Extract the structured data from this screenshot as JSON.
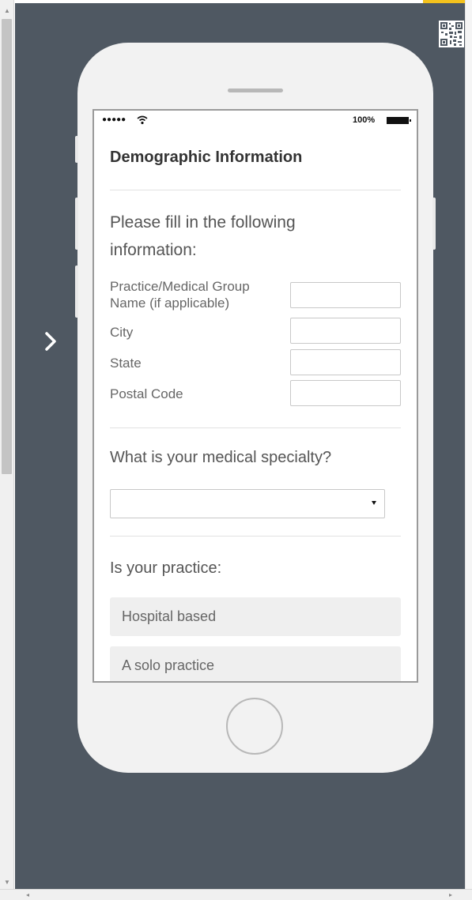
{
  "status_bar": {
    "signal": "●●●●●",
    "battery_percent": "100%"
  },
  "form": {
    "title": "Demographic Information",
    "intro": "Please fill in the following information:",
    "fields": [
      {
        "label": "Practice/Medical Group Name (if applicable)",
        "value": ""
      },
      {
        "label": "City",
        "value": ""
      },
      {
        "label": "State",
        "value": ""
      },
      {
        "label": "Postal Code",
        "value": ""
      }
    ],
    "specialty_question": "What is your medical specialty?",
    "specialty_selected": "",
    "practice_question": "Is your practice:",
    "practice_options": [
      "Hospital based",
      "A solo practice"
    ]
  },
  "icons": {
    "qr": "qr-code-icon",
    "nav": "chevron-right-icon",
    "wifi": "wifi-icon",
    "battery": "battery-icon",
    "select_arrow": "caret-down-icon"
  },
  "colors": {
    "canvas": "#4f5862",
    "phone_body": "#f2f2f2",
    "accent": "#f4c21d"
  }
}
